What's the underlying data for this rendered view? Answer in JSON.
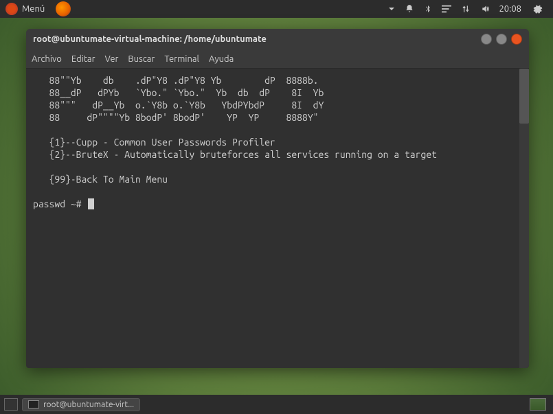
{
  "topbar": {
    "menu_label": "Menú",
    "clock": "20:08"
  },
  "window": {
    "title": "root@ubuntumate-virtual-machine: /home/ubuntumate"
  },
  "menubar": {
    "archivo": "Archivo",
    "editar": "Editar",
    "ver": "Ver",
    "buscar": "Buscar",
    "terminal": "Terminal",
    "ayuda": "Ayuda"
  },
  "terminal": {
    "ascii_line1": "   88\"\"Yb    db    .dP\"Y8 .dP\"Y8 Yb        dP  8888b.",
    "ascii_line2": "   88__dP   dPYb   `Ybo.\" `Ybo.\"  Yb  db  dP    8I  Yb",
    "ascii_line3": "   88\"\"\"   dP__Yb  o.`Y8b o.`Y8b   YbdPYbdP     8I  dY",
    "ascii_line4": "   88     dP\"\"\"\"Yb 8bodP' 8bodP'    YP  YP     8888Y\"",
    "opt1": "   {1}--Cupp - Common User Passwords Profiler",
    "opt2": "   {2}--BruteX - Automatically bruteforces all services running on a target",
    "opt99": "   {99}-Back To Main Menu",
    "prompt": "passwd ~# "
  },
  "taskbar": {
    "task_label": "root@ubuntumate-virt..."
  }
}
